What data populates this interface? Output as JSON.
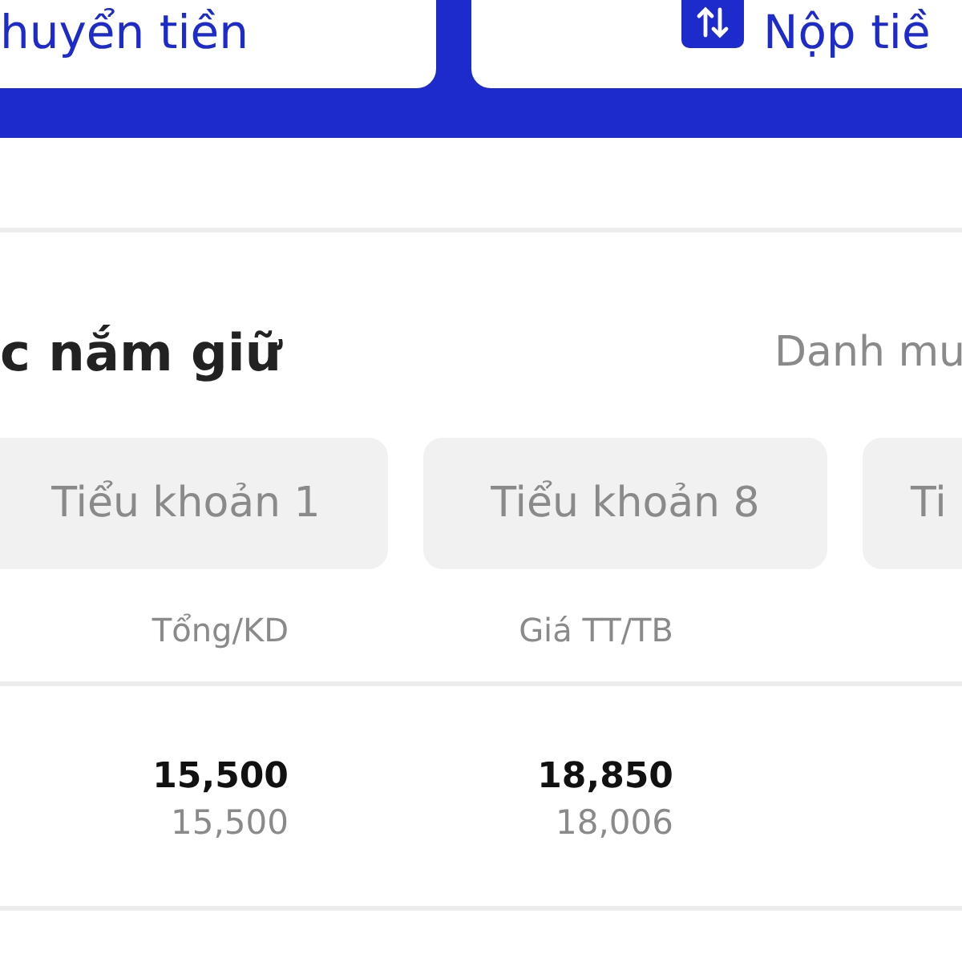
{
  "top_actions": [
    {
      "label": "huyển tiền",
      "has_icon": false
    },
    {
      "label": "Nộp tiề",
      "has_icon": true
    }
  ],
  "section": {
    "title": "c nắm giữ",
    "link": "Danh mu"
  },
  "sub_accounts": [
    {
      "label": "Tiểu khoản 1",
      "selected": false
    },
    {
      "label": "Tiểu khoản 8",
      "selected": false
    },
    {
      "label": "Ti",
      "selected": false
    }
  ],
  "columns": [
    "Tổng/KD",
    "Giá TT/TB"
  ],
  "rows": [
    {
      "cells": [
        {
          "main": "15,500",
          "sub": "15,500"
        },
        {
          "main": "18,850",
          "sub": "18,006"
        }
      ]
    }
  ]
}
